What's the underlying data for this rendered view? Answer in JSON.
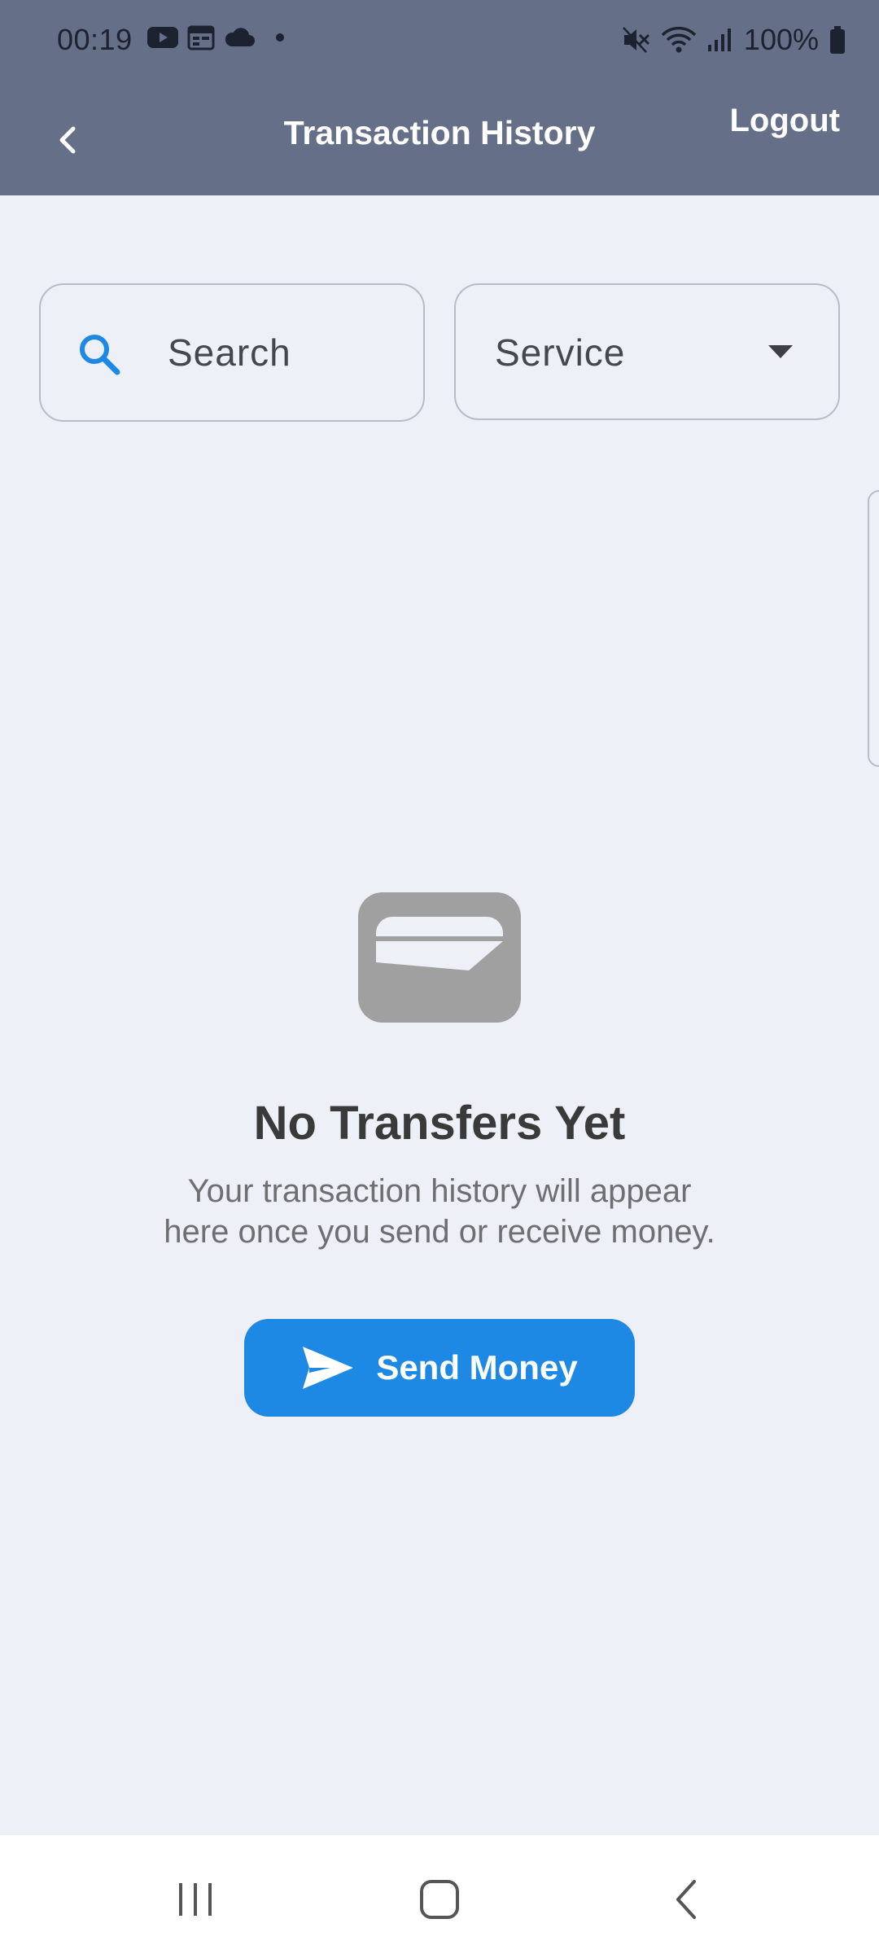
{
  "status_bar": {
    "time": "00:19",
    "battery": "100%",
    "left_icons": [
      "youtube-icon",
      "calendar-icon",
      "cloud-icon",
      "dot-icon"
    ],
    "right_icons": [
      "mute-icon",
      "wifi-icon",
      "signal-icon",
      "battery-icon"
    ]
  },
  "app_bar": {
    "title": "Transaction History",
    "logout_label": "Logout",
    "back_icon": "chevron-left-icon"
  },
  "filters": {
    "search_placeholder": "Search",
    "service_label": "Service"
  },
  "empty_state": {
    "icon": "wallet-icon",
    "title": "No Transfers Yet",
    "message_line1": "Your transaction history will appear",
    "message_line2": "here once you send or receive money.",
    "button_label": "Send Money",
    "button_icon": "send-icon"
  },
  "nav_bar": {
    "icons": [
      "recent-apps-icon",
      "home-icon",
      "back-icon"
    ]
  },
  "colors": {
    "header": "#666f88",
    "background": "#edf0f7",
    "accent": "#1e88e5",
    "empty_icon": "#a0a0a0"
  }
}
